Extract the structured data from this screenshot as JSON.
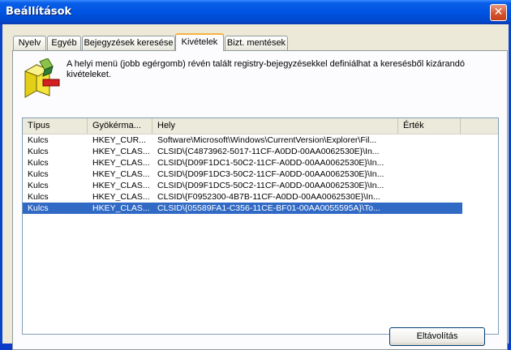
{
  "window": {
    "title": "Beállítások",
    "close_glyph": "✕"
  },
  "tabs": [
    {
      "label": "Nyelv"
    },
    {
      "label": "Egyéb"
    },
    {
      "label": "Bejegyzések keresése"
    },
    {
      "label": "Kivételek",
      "active": true
    },
    {
      "label": "Bizt. mentések"
    }
  ],
  "description": "A helyi menü (jobb egérgomb) révén talált registry-bejegyzésekkel definiálhat a keresésből kizárandó kivételeket.",
  "icon": "registry-exclusion-icon",
  "list": {
    "columns": [
      "Típus",
      "Gyökérma...",
      "Hely",
      "Érték"
    ],
    "rows": [
      {
        "type": "Kulcs",
        "root": "HKEY_CUR...",
        "location": "Software\\Microsoft\\Windows\\CurrentVersion\\Explorer\\Fil...",
        "value": ""
      },
      {
        "type": "Kulcs",
        "root": "HKEY_CLAS...",
        "location": "CLSID\\{C4873962-5017-11CF-A0DD-00AA0062530E}\\In...",
        "value": ""
      },
      {
        "type": "Kulcs",
        "root": "HKEY_CLAS...",
        "location": "CLSID\\{D09F1DC1-50C2-11CF-A0DD-00AA0062530E}\\In...",
        "value": ""
      },
      {
        "type": "Kulcs",
        "root": "HKEY_CLAS...",
        "location": "CLSID\\{D09F1DC3-50C2-11CF-A0DD-00AA0062530E}\\In...",
        "value": ""
      },
      {
        "type": "Kulcs",
        "root": "HKEY_CLAS...",
        "location": "CLSID\\{D09F1DC5-50C2-11CF-A0DD-00AA0062530E}\\In...",
        "value": ""
      },
      {
        "type": "Kulcs",
        "root": "HKEY_CLAS...",
        "location": "CLSID\\{F0952300-4B7B-11CF-A0DD-00AA0062530E}\\In...",
        "value": ""
      },
      {
        "type": "Kulcs",
        "root": "HKEY_CLAS...",
        "location": "CLSID\\{05589FA1-C356-11CE-BF01-00AA0055595A}\\To...",
        "value": "",
        "selected": true
      }
    ]
  },
  "buttons": {
    "remove": "Eltávolítás"
  },
  "colors": {
    "selection": "#316ac5",
    "active_tab_accent": "#f8b33e",
    "titlebar": "#0054e3"
  }
}
